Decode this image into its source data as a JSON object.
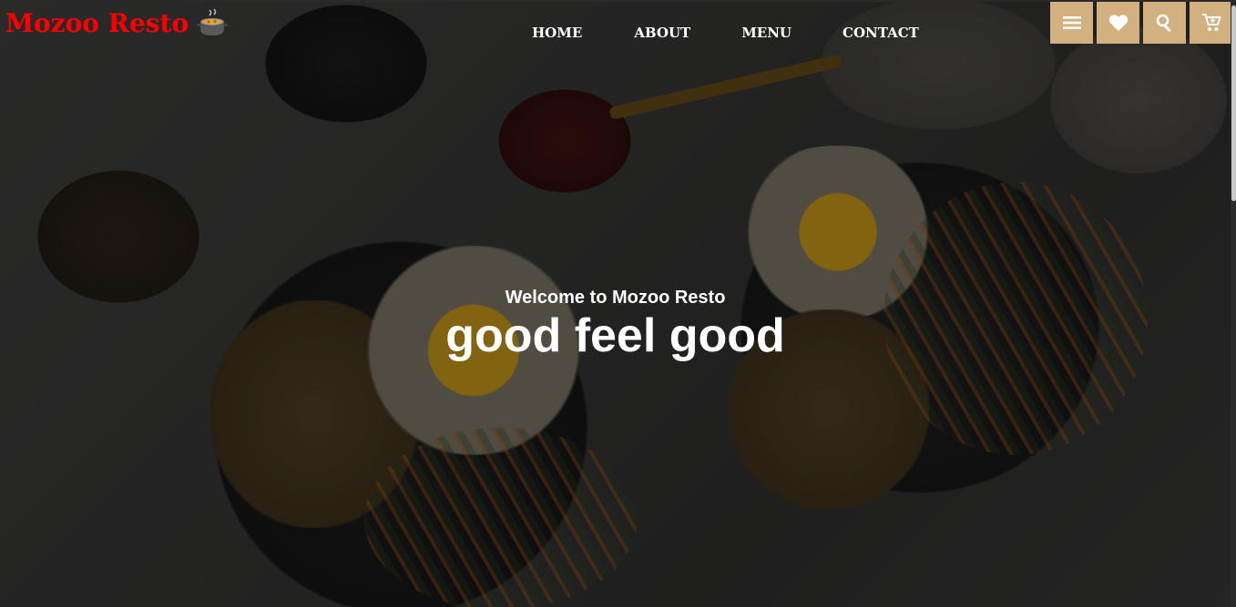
{
  "brand": {
    "name": "Mozoo Resto",
    "logo_icon": "cooking-pot-icon",
    "color": "#ff0000"
  },
  "nav": {
    "items": [
      {
        "label": "HOME"
      },
      {
        "label": "ABOUT"
      },
      {
        "label": "MENU"
      },
      {
        "label": "CONTACT"
      }
    ]
  },
  "header_icons": [
    {
      "icon": "menu-bars-icon"
    },
    {
      "icon": "heart-icon"
    },
    {
      "icon": "search-icon"
    },
    {
      "icon": "cart-icon"
    }
  ],
  "hero": {
    "welcome": "Welcome to Mozoo Resto",
    "tagline": "good feel good"
  },
  "colors": {
    "accent": "#d3b07f",
    "text": "#ffffff"
  }
}
